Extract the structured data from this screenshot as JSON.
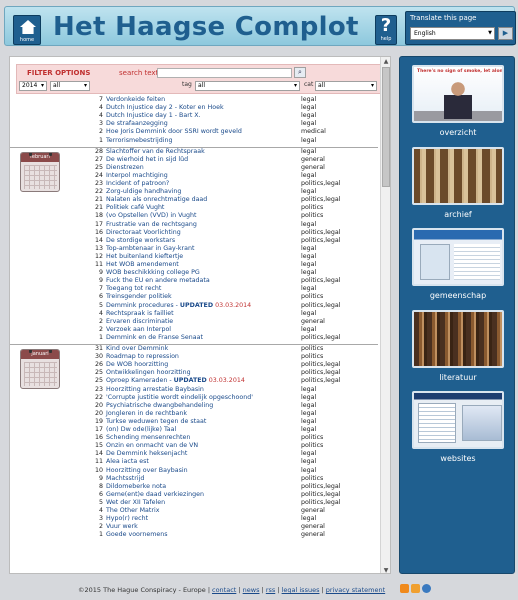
{
  "header": {
    "home_label": "home",
    "title": "Het Haagse Complot",
    "help_label": "help",
    "translate_title": "Translate this page",
    "language": "English"
  },
  "filter": {
    "title": "FILTER OPTIONS",
    "search_label": "search text",
    "year": "2014",
    "month": "all",
    "tag_label": "tag",
    "tag_value": "all",
    "cat_label": "cat",
    "cat_value": "all"
  },
  "months": [
    {
      "name": "",
      "rows": [
        {
          "d": "7",
          "t": "Verdonkeide feiten",
          "n": "",
          "c": "legal"
        },
        {
          "d": "4",
          "t": "Dutch Injustice day 2 - Koter en Hoek",
          "n": "",
          "c": "legal"
        },
        {
          "d": "4",
          "t": "Dutch Injustice day 1 - Bart X.",
          "n": "",
          "c": "legal"
        },
        {
          "d": "3",
          "t": "De strafaanzegging",
          "n": "",
          "c": "legal"
        },
        {
          "d": "2",
          "t": "Hoe Joris Demmink door SSRI wordt geveld",
          "n": "",
          "c": "medical"
        },
        {
          "d": "1",
          "t": "Terrorismebestrijding",
          "n": "",
          "c": "legal"
        }
      ]
    },
    {
      "name": "februari",
      "rows": [
        {
          "d": "28",
          "t": "Slachtoffer van de Rechtspraak",
          "n": "",
          "c": "legal"
        },
        {
          "d": "27",
          "t": "De wierhoid het in sijd lûd",
          "n": "",
          "c": "general"
        },
        {
          "d": "25",
          "t": "Dienstrezen",
          "n": "",
          "c": "general"
        },
        {
          "d": "24",
          "t": "Interpol machtiging",
          "n": "",
          "c": "legal"
        },
        {
          "d": "23",
          "t": "Incident of patroon?",
          "n": "",
          "c": "politics,legal"
        },
        {
          "d": "22",
          "t": "Zorg-uldige handhaving",
          "n": "",
          "c": "legal"
        },
        {
          "d": "21",
          "t": "Nalaten als onrechtmatige daad",
          "n": "",
          "c": "politics,legal"
        },
        {
          "d": "21",
          "t": "Politiek café Vught",
          "n": "",
          "c": "politics"
        },
        {
          "d": "18",
          "t": "(vo Opstellen (VVD) in Vught",
          "n": "",
          "c": "politics"
        },
        {
          "d": "17",
          "t": "Frustratie van de rechtsgang",
          "n": "",
          "c": "legal"
        },
        {
          "d": "16",
          "t": "Directoraat Voorlichting",
          "n": "",
          "c": "politics,legal"
        },
        {
          "d": "14",
          "t": "De stordige workstars",
          "n": "",
          "c": "politics,legal"
        },
        {
          "d": "13",
          "t": "Top-ambtenaar in Gay-krant",
          "n": "",
          "c": "legal"
        },
        {
          "d": "12",
          "t": "Het buitenland kieftertje",
          "n": "",
          "c": "legal"
        },
        {
          "d": "11",
          "t": "Het WOB amendement",
          "n": "",
          "c": "legal"
        },
        {
          "d": "9",
          "t": "WOB beschikkking college PG",
          "n": "",
          "c": "legal"
        },
        {
          "d": "9",
          "t": "Fuck the EU en andere metadata",
          "n": "",
          "c": "politics,legal"
        },
        {
          "d": "7",
          "t": "Toegang tot recht",
          "n": "",
          "c": "legal"
        },
        {
          "d": "6",
          "t": "Treinsgender politiek",
          "n": "",
          "c": "politics"
        },
        {
          "d": "5",
          "t": "Demmink procedures - ",
          "upd": "UPDATED",
          "ud": " 03.03.2014",
          "n": "",
          "c": "politics,legal"
        },
        {
          "d": "4",
          "t": "Rechtspraak is failliet",
          "n": "",
          "c": "legal"
        },
        {
          "d": "2",
          "t": "Ervaren discriminatie",
          "n": "",
          "c": "general"
        },
        {
          "d": "2",
          "t": "Verzoek aan Interpol",
          "n": "",
          "c": "legal"
        },
        {
          "d": "1",
          "t": "Demmink en de Franse Senaat",
          "n": "",
          "c": "politics,legal"
        }
      ]
    },
    {
      "name": "januari",
      "rows": [
        {
          "d": "31",
          "t": "Kind over Demmink",
          "n": "",
          "c": "politics"
        },
        {
          "d": "30",
          "t": "Roadmap to repression",
          "n": "",
          "c": "politics"
        },
        {
          "d": "26",
          "t": "De WOB hoorzitting",
          "n": "",
          "c": "politics,legal"
        },
        {
          "d": "25",
          "t": "Ontwikkelingen hoorzitting",
          "n": "",
          "c": "politics,legal"
        },
        {
          "d": "25",
          "t": "Oproep Kameraden - ",
          "upd": "UPDATED",
          "ud": " 03.03.2014",
          "n": "",
          "c": "politics,legal"
        },
        {
          "d": "23",
          "t": "Hoorzitting arrestatie Baybasin",
          "n": "",
          "c": "legal"
        },
        {
          "d": "22",
          "t": "'Corrupte justitie wordt eindelijk opgeschoond'",
          "n": "",
          "c": "legal"
        },
        {
          "d": "20",
          "t": "Psychiatrische dwangbehandeling",
          "n": "",
          "c": "legal"
        },
        {
          "d": "20",
          "t": "Jongleren in de rechtbank",
          "n": "",
          "c": "legal"
        },
        {
          "d": "19",
          "t": "Turkse weduwen tegen de staat",
          "n": "",
          "c": "legal"
        },
        {
          "d": "17",
          "t": "(on) Dw ode(lijke) Taal",
          "n": "",
          "c": "legal"
        },
        {
          "d": "16",
          "t": "Schending mensenrechten",
          "n": "",
          "c": "politics"
        },
        {
          "d": "15",
          "t": "Onzin en onmacht van de VN",
          "n": "",
          "c": "politics"
        },
        {
          "d": "14",
          "t": "De Demmink heksenjacht",
          "n": "",
          "c": "legal"
        },
        {
          "d": "11",
          "t": "Alea iacta est",
          "n": "",
          "c": "legal"
        },
        {
          "d": "10",
          "t": "Hoorzitting over Baybasin",
          "n": "",
          "c": "legal"
        },
        {
          "d": "9",
          "t": "Machtsstrijd",
          "n": "",
          "c": "politics"
        },
        {
          "d": "8",
          "t": "Dildomeberke nota",
          "n": "",
          "c": "politics,legal"
        },
        {
          "d": "6",
          "t": "Geme(ent)e daad verkiezingen",
          "n": "",
          "c": "politics,legal"
        },
        {
          "d": "5",
          "t": "Wet der XII Tafelen",
          "n": "",
          "c": "politics,legal"
        },
        {
          "d": "4",
          "t": "The Other Matrix",
          "n": "",
          "c": "general"
        },
        {
          "d": "3",
          "t": "Hypo(r) recht",
          "n": "",
          "c": "legal"
        },
        {
          "d": "2",
          "t": "Vuur werk",
          "n": "",
          "c": "general"
        },
        {
          "d": "1",
          "t": "Goede voornemens",
          "n": "",
          "c": "general"
        }
      ]
    }
  ],
  "sidebar": {
    "speech": "There's no sign of smoke, let alone any fire...",
    "items": [
      {
        "label": "overzicht",
        "icon": "overview-image"
      },
      {
        "label": "archief",
        "icon": "archive-image"
      },
      {
        "label": "gemeenschap",
        "icon": "community-image"
      },
      {
        "label": "literatuur",
        "icon": "books-image"
      },
      {
        "label": "websites",
        "icon": "websites-image"
      }
    ]
  },
  "footer": {
    "copyright": "©2015 The Hague Conspiracy - Europe |",
    "links": [
      "contact",
      "news",
      "rss",
      "legal issues",
      "privacy statement"
    ]
  }
}
